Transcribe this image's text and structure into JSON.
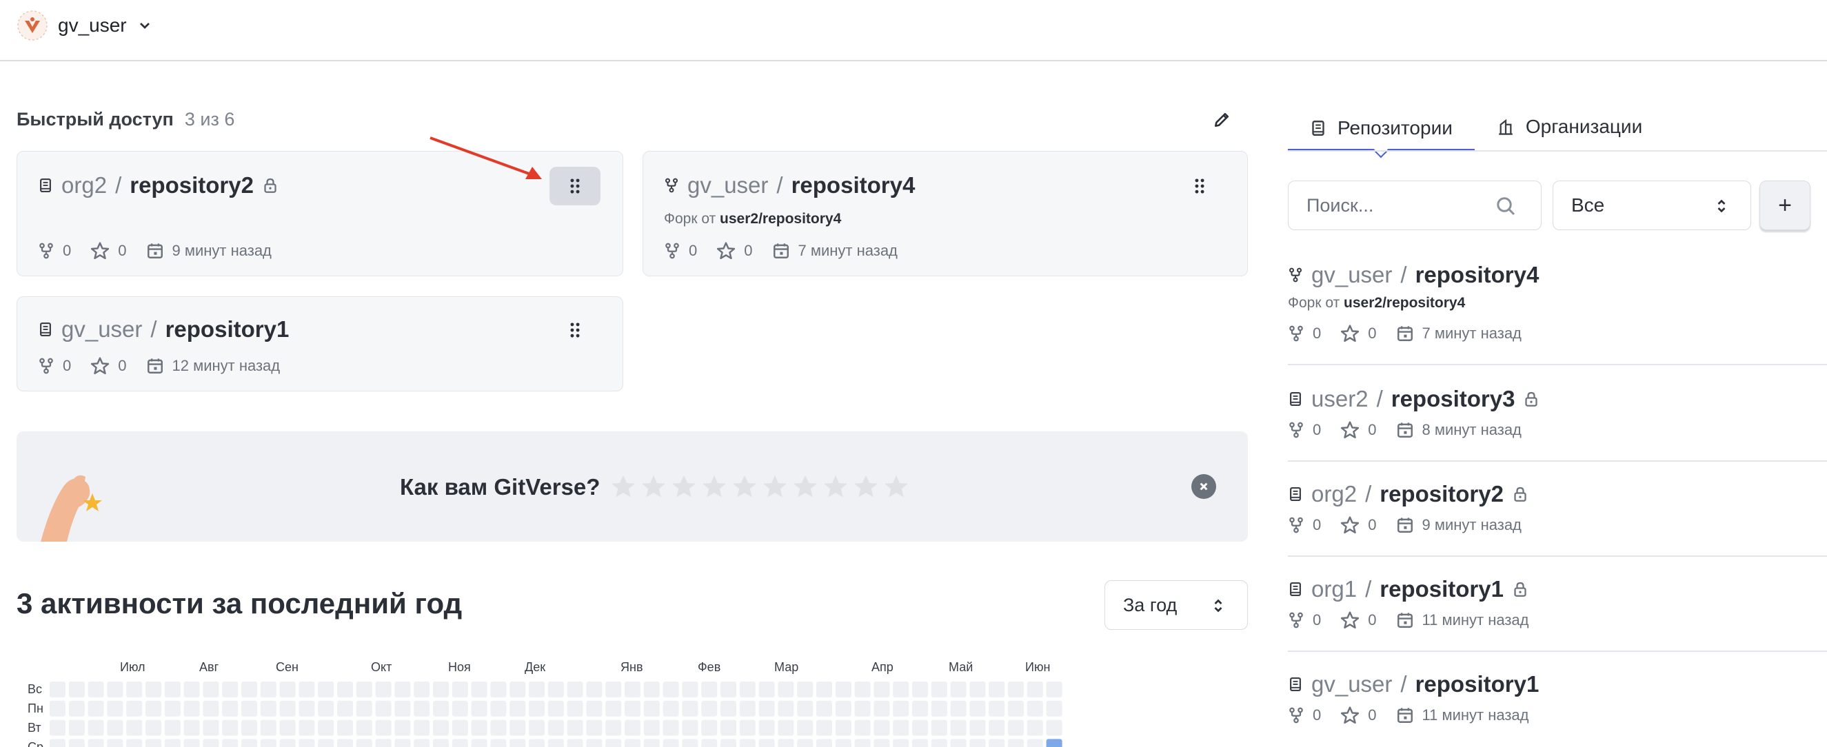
{
  "header": {
    "user_name": "gv_user",
    "dropdown_icon": "chevron-down-icon"
  },
  "quick_access": {
    "title": "Быстрый доступ",
    "count": "3 из 6",
    "cards": [
      {
        "owner": "org2",
        "sep": "/",
        "repo": "repository2",
        "private": true,
        "type": "repo",
        "forks": "0",
        "stars": "0",
        "updated": "9 минут назад"
      },
      {
        "owner": "gv_user",
        "sep": "/",
        "repo": "repository4",
        "private": false,
        "type": "fork",
        "fork_label": "Форк от",
        "fork_source": "user2/repository4",
        "forks": "0",
        "stars": "0",
        "updated": "7 минут назад"
      },
      {
        "owner": "gv_user",
        "sep": "/",
        "repo": "repository1",
        "private": false,
        "type": "repo",
        "forks": "0",
        "stars": "0",
        "updated": "12 минут назад"
      }
    ]
  },
  "rating_banner": {
    "question": "Как вам GitVerse?",
    "star_count": 10
  },
  "activity": {
    "title": "3 активности за последний год",
    "period": "За год",
    "months": [
      "Июл",
      "Авг",
      "Сен",
      "Окт",
      "Ноя",
      "Дек",
      "Янв",
      "Фев",
      "Мар",
      "Апр",
      "Май",
      "Июн"
    ],
    "days": [
      "Вс",
      "Пн",
      "Вт",
      "Ср"
    ],
    "active_color": "#7fa8e8",
    "empty_color": "#eef0f3"
  },
  "sidebar": {
    "tabs": [
      {
        "label": "Репозитории",
        "icon": "repo-icon",
        "active": true
      },
      {
        "label": "Организации",
        "icon": "organization-icon",
        "active": false
      }
    ],
    "search_placeholder": "Поиск...",
    "filter": "Все",
    "add_label": "+",
    "repos": [
      {
        "owner": "gv_user",
        "sep": "/",
        "repo": "repository4",
        "type": "fork",
        "private": false,
        "fork_label": "Форк от",
        "fork_source": "user2/repository4",
        "forks": "0",
        "stars": "0",
        "updated": "7 минут назад"
      },
      {
        "owner": "user2",
        "sep": "/",
        "repo": "repository3",
        "type": "repo",
        "private": true,
        "forks": "0",
        "stars": "0",
        "updated": "8 минут назад"
      },
      {
        "owner": "org2",
        "sep": "/",
        "repo": "repository2",
        "type": "repo",
        "private": true,
        "forks": "0",
        "stars": "0",
        "updated": "9 минут назад"
      },
      {
        "owner": "org1",
        "sep": "/",
        "repo": "repository1",
        "type": "repo",
        "private": true,
        "forks": "0",
        "stars": "0",
        "updated": "11 минут назад"
      },
      {
        "owner": "gv_user",
        "sep": "/",
        "repo": "repository1",
        "type": "repo",
        "private": false,
        "forks": "0",
        "stars": "0",
        "updated": "11 минут назад"
      }
    ]
  },
  "colors": {
    "accent": "#4f5fd6",
    "annotation_arrow": "#e23b2a"
  }
}
